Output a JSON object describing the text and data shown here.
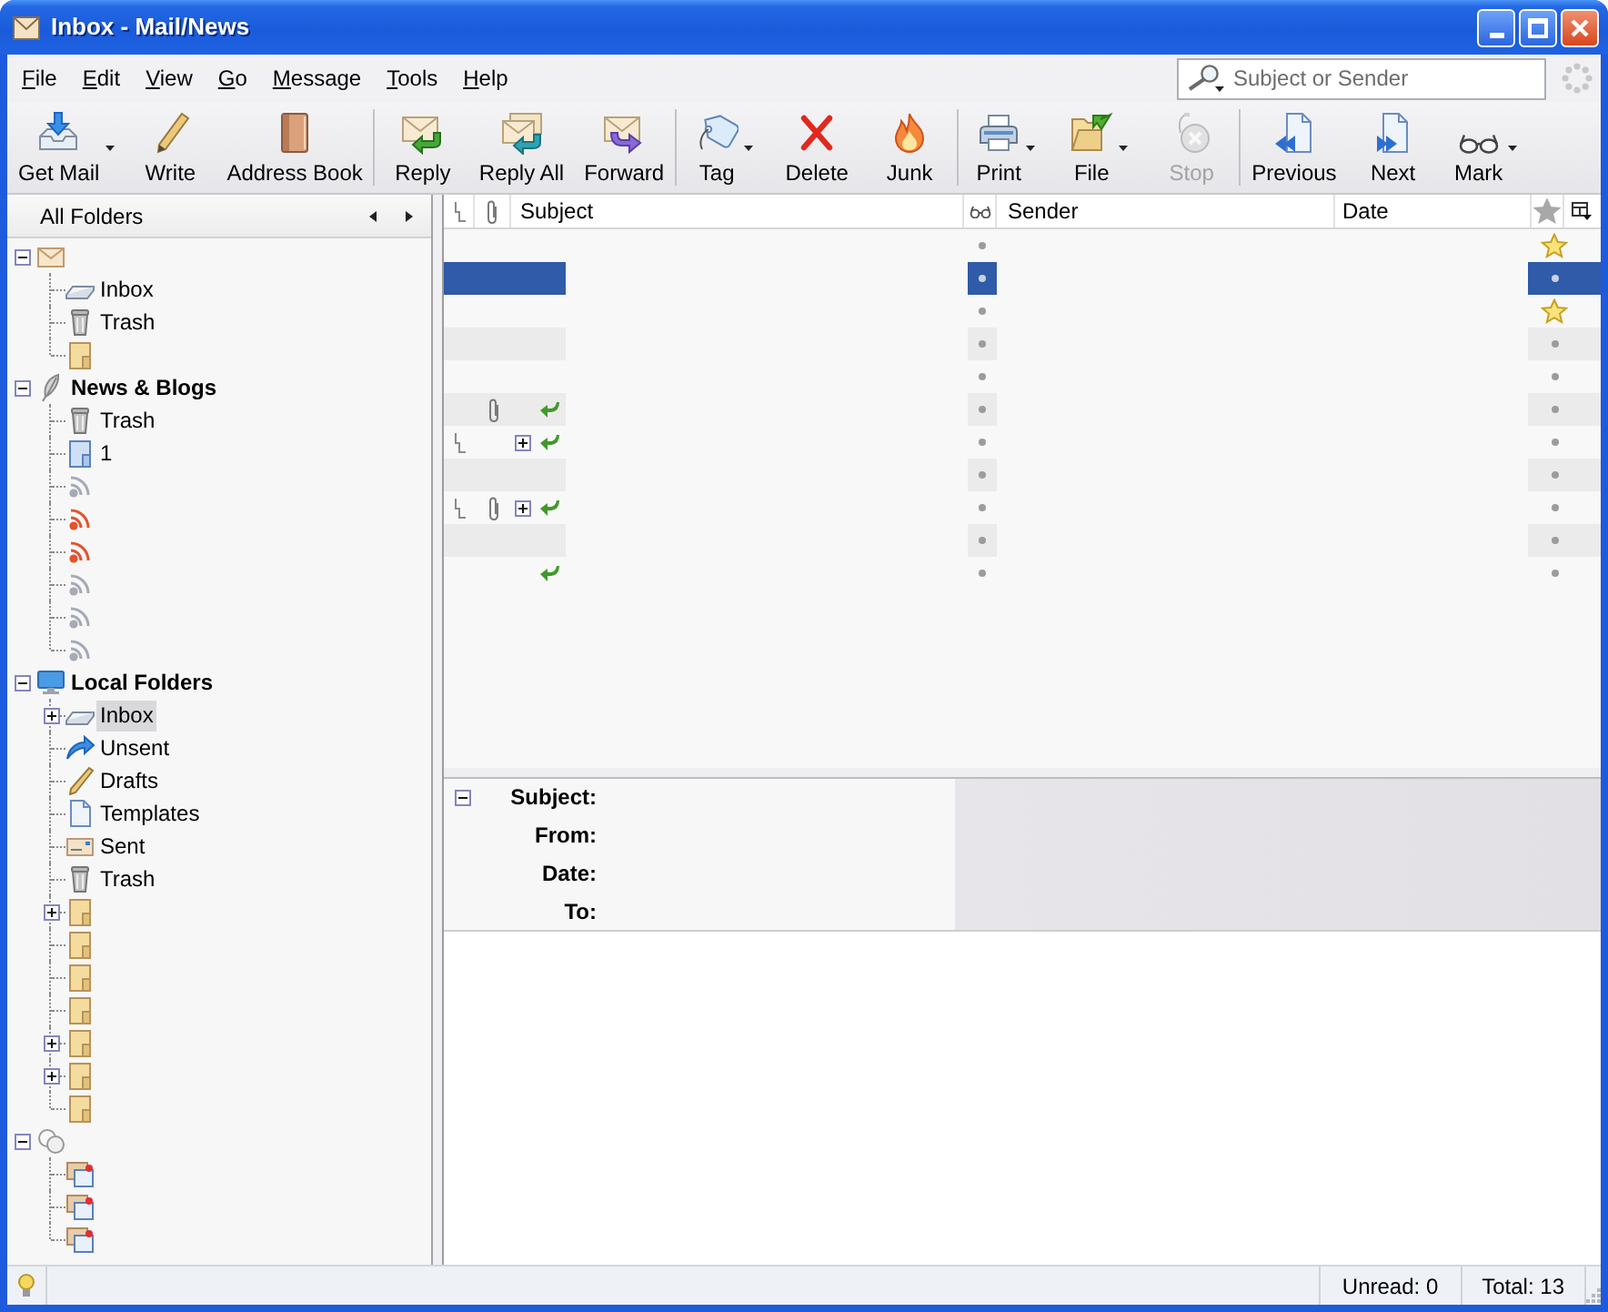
{
  "window": {
    "title": "Inbox - Mail/News"
  },
  "menu": [
    "File",
    "Edit",
    "View",
    "Go",
    "Message",
    "Tools",
    "Help"
  ],
  "search": {
    "placeholder": "Subject or Sender"
  },
  "toolbar": [
    [
      {
        "label": "Get Mail",
        "dropdown": true,
        "disabled": false
      },
      {
        "label": "Write",
        "dropdown": false,
        "disabled": false
      },
      {
        "label": "Address Book",
        "dropdown": false,
        "disabled": false
      }
    ],
    [
      {
        "label": "Reply",
        "dropdown": false,
        "disabled": false
      },
      {
        "label": "Reply All",
        "dropdown": false,
        "disabled": false
      },
      {
        "label": "Forward",
        "dropdown": false,
        "disabled": false
      }
    ],
    [
      {
        "label": "Tag",
        "dropdown": true,
        "disabled": false
      },
      {
        "label": "Delete",
        "dropdown": false,
        "disabled": false
      },
      {
        "label": "Junk",
        "dropdown": false,
        "disabled": false
      }
    ],
    [
      {
        "label": "Print",
        "dropdown": true,
        "disabled": false
      },
      {
        "label": "File",
        "dropdown": true,
        "disabled": false
      },
      {
        "label": "Stop",
        "dropdown": false,
        "disabled": true
      }
    ],
    [
      {
        "label": "Previous",
        "dropdown": false,
        "disabled": false
      },
      {
        "label": "Next",
        "dropdown": false,
        "disabled": false
      },
      {
        "label": "Mark",
        "dropdown": true,
        "disabled": false
      }
    ]
  ],
  "folder_pane": {
    "header": "All Folders",
    "tree": [
      {
        "kind": "mail_account",
        "expanded": true,
        "selected": false,
        "children": [
          {
            "kind": "inbox",
            "label": "Inbox",
            "selected": false
          },
          {
            "kind": "trash",
            "label": "Trash",
            "selected": false
          },
          {
            "kind": "folder",
            "selected": false
          }
        ]
      },
      {
        "kind": "news_account",
        "label": "News & Blogs",
        "expanded": true,
        "selected": false,
        "children": [
          {
            "kind": "trash",
            "label": "Trash",
            "selected": false
          },
          {
            "kind": "feed_folder",
            "label": "1",
            "selected": false
          },
          {
            "kind": "feed",
            "unread": false,
            "selected": false
          },
          {
            "kind": "feed",
            "unread": true,
            "selected": false
          },
          {
            "kind": "feed",
            "unread": true,
            "selected": false
          },
          {
            "kind": "feed",
            "unread": false,
            "selected": false
          },
          {
            "kind": "feed",
            "unread": false,
            "selected": false
          },
          {
            "kind": "feed",
            "unread": false,
            "selected": false
          }
        ]
      },
      {
        "kind": "local_account",
        "label": "Local Folders",
        "expanded": true,
        "selected": false,
        "children": [
          {
            "kind": "inbox",
            "label": "Inbox",
            "expanded": false,
            "selected": true
          },
          {
            "kind": "unsent",
            "label": "Unsent",
            "selected": false
          },
          {
            "kind": "drafts",
            "label": "Drafts",
            "selected": false
          },
          {
            "kind": "templates",
            "label": "Templates",
            "selected": false
          },
          {
            "kind": "sent",
            "label": "Sent",
            "selected": false
          },
          {
            "kind": "trash",
            "label": "Trash",
            "selected": false
          },
          {
            "kind": "folder",
            "expanded": false,
            "selected": false
          },
          {
            "kind": "folder",
            "selected": false
          },
          {
            "kind": "folder",
            "selected": false
          },
          {
            "kind": "folder",
            "selected": false
          },
          {
            "kind": "folder",
            "expanded": false,
            "selected": false
          },
          {
            "kind": "folder",
            "expanded": false,
            "selected": false
          },
          {
            "kind": "folder",
            "selected": false
          }
        ]
      },
      {
        "kind": "chat_account",
        "expanded": true,
        "selected": false,
        "children": [
          {
            "kind": "chat",
            "selected": false
          },
          {
            "kind": "chat",
            "selected": false
          },
          {
            "kind": "chat",
            "selected": false
          }
        ]
      }
    ]
  },
  "thread_pane": {
    "columns": [
      "Subject",
      "Sender",
      "Date"
    ],
    "rows": [
      {
        "selected": false,
        "in_thread": false,
        "attachment": false,
        "collapsed": false,
        "replied": false,
        "starred": true
      },
      {
        "selected": true,
        "in_thread": false,
        "attachment": false,
        "collapsed": false,
        "replied": false,
        "starred": false
      },
      {
        "selected": false,
        "in_thread": false,
        "attachment": false,
        "collapsed": false,
        "replied": false,
        "starred": true
      },
      {
        "selected": false,
        "in_thread": false,
        "attachment": false,
        "collapsed": false,
        "replied": false,
        "starred": false
      },
      {
        "selected": false,
        "in_thread": false,
        "attachment": false,
        "collapsed": false,
        "replied": false,
        "starred": false
      },
      {
        "selected": false,
        "in_thread": false,
        "attachment": true,
        "collapsed": false,
        "replied": true,
        "starred": false
      },
      {
        "selected": false,
        "in_thread": true,
        "attachment": false,
        "collapsed": true,
        "replied": true,
        "starred": false
      },
      {
        "selected": false,
        "in_thread": false,
        "attachment": false,
        "collapsed": false,
        "replied": false,
        "starred": false
      },
      {
        "selected": false,
        "in_thread": true,
        "attachment": true,
        "collapsed": true,
        "replied": true,
        "starred": false
      },
      {
        "selected": false,
        "in_thread": false,
        "attachment": false,
        "collapsed": false,
        "replied": false,
        "starred": false
      },
      {
        "selected": false,
        "in_thread": false,
        "attachment": false,
        "collapsed": false,
        "replied": true,
        "starred": false
      }
    ]
  },
  "message_header": {
    "expanded": true,
    "fields": [
      "Subject:",
      "From:",
      "Date:",
      "To:"
    ]
  },
  "status_bar": {
    "unread": "Unread: 0",
    "total": "Total: 13"
  }
}
